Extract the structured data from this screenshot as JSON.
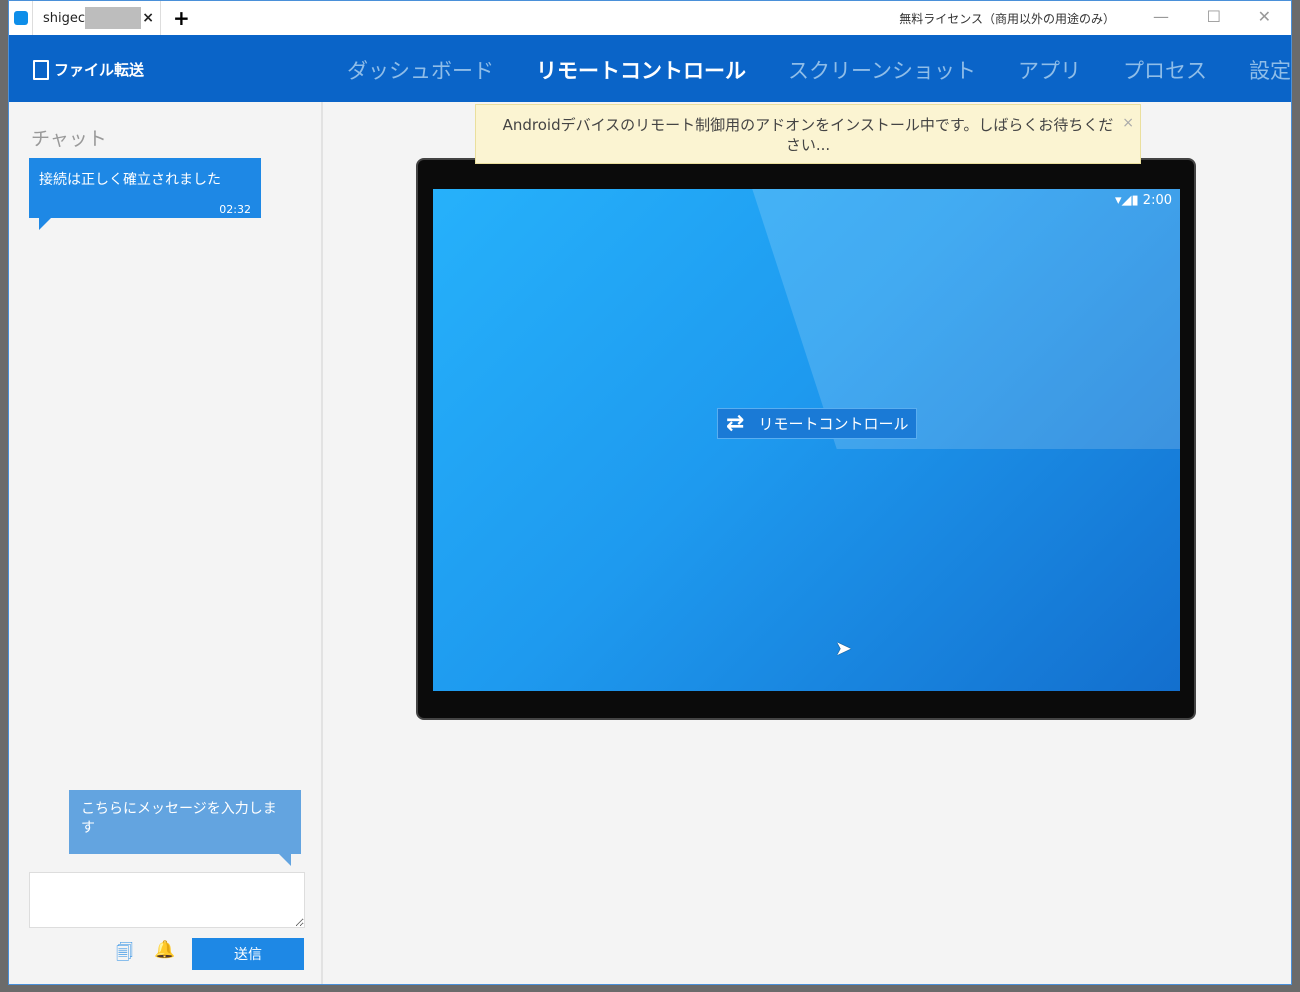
{
  "titlebar": {
    "tab_label": "shigec",
    "new_tab": "+",
    "license": "無料ライセンス（商用以外の用途のみ）",
    "minimize": "—",
    "maximize": "☐",
    "close": "✕"
  },
  "nav": {
    "file_transfer": "ファイル転送",
    "items": [
      {
        "label": "ダッシュボード"
      },
      {
        "label": "リモートコントロール"
      },
      {
        "label": "スクリーンショット"
      },
      {
        "label": "アプリ"
      },
      {
        "label": "プロセス"
      },
      {
        "label": "設定"
      }
    ]
  },
  "chat": {
    "heading": "チャット",
    "message": "接続は正しく確立されました",
    "time": "02:32",
    "hint": "こちらにメッセージを入力します",
    "send": "送信"
  },
  "notice": {
    "text": "Androidデバイスのリモート制御用のアドオンをインストール中です。しばらくお待ちください...",
    "close": "×"
  },
  "device": {
    "status_time": "▾◢▮ 2:00",
    "rc_label": "リモートコントロール",
    "rc_icon": "⇄"
  }
}
